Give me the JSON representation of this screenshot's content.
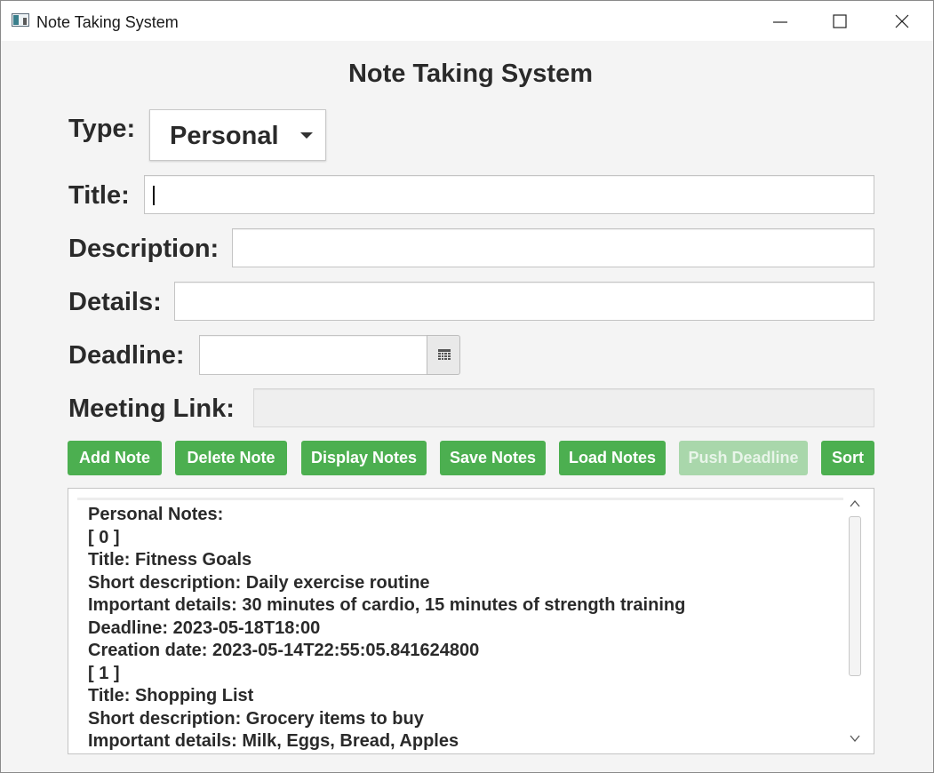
{
  "window": {
    "title": "Note Taking System",
    "controls": {
      "minimize": "minimize-icon",
      "maximize": "maximize-icon",
      "close": "close-icon"
    }
  },
  "heading": "Note Taking System",
  "form": {
    "type_label": "Type:",
    "type_value": "Personal",
    "title_label": "Title:",
    "title_value": "",
    "description_label": "Description:",
    "description_value": "",
    "details_label": "Details:",
    "details_value": "",
    "deadline_label": "Deadline:",
    "deadline_value": "",
    "meeting_link_label": "Meeting Link:",
    "meeting_link_value": "",
    "meeting_link_enabled": false
  },
  "buttons": {
    "add_note": "Add Note",
    "delete_note": "Delete Note",
    "display_notes": "Display Notes",
    "save_notes": "Save Notes",
    "load_notes": "Load Notes",
    "push_deadline": "Push Deadline",
    "push_deadline_enabled": false,
    "sort": "Sort"
  },
  "output": {
    "lines": [
      "Personal Notes:",
      "[ 0 ]",
      "Title: Fitness Goals",
      "Short description: Daily exercise routine",
      "Important details: 30 minutes of cardio, 15 minutes of strength training",
      "Deadline: 2023-05-18T18:00",
      "Creation date: 2023-05-14T22:55:05.841624800",
      "[ 1 ]",
      "Title: Shopping List",
      "Short description: Grocery items to buy",
      "Important details: Milk, Eggs, Bread, Apples"
    ]
  },
  "colors": {
    "button_green": "#4caf50",
    "button_disabled": "#a9d7ab",
    "background": "#f4f4f4",
    "text": "#2a2a2a"
  }
}
